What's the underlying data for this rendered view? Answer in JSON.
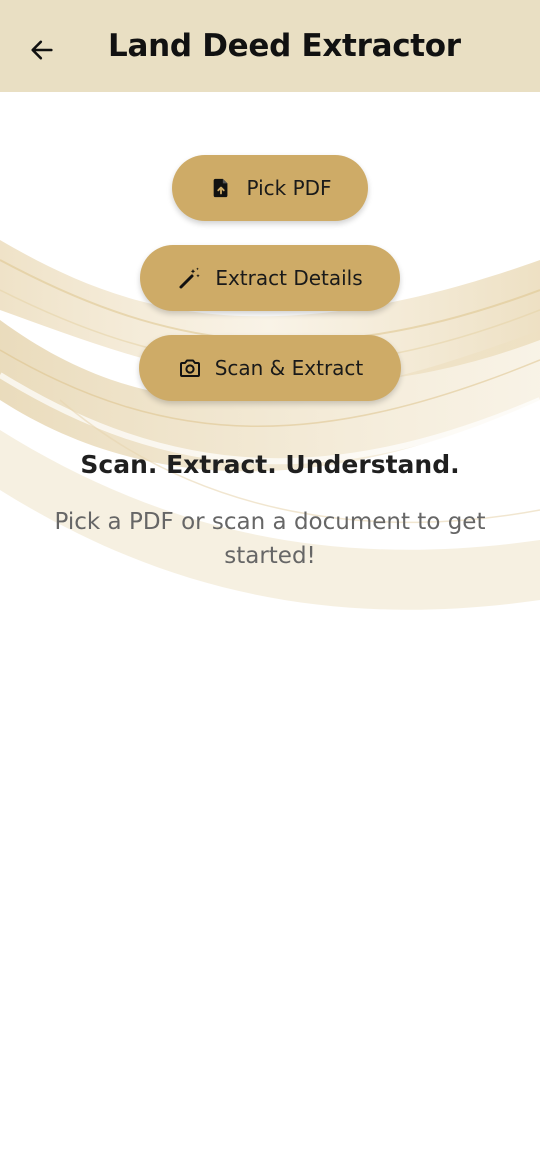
{
  "app_bar": {
    "title": "Land Deed Extractor",
    "back_icon": "arrow-left-icon",
    "background": "#e9dfc3"
  },
  "actions": [
    {
      "label": "Pick PDF",
      "icon": "file-upload-icon"
    },
    {
      "label": "Extract Details",
      "icon": "magic-wand-icon"
    },
    {
      "label": "Scan & Extract",
      "icon": "camera-icon"
    }
  ],
  "accent_color": "#ceab67",
  "hero": {
    "tagline": "Scan. Extract. Understand.",
    "subtext": "Pick a PDF or scan a document to get started!"
  }
}
